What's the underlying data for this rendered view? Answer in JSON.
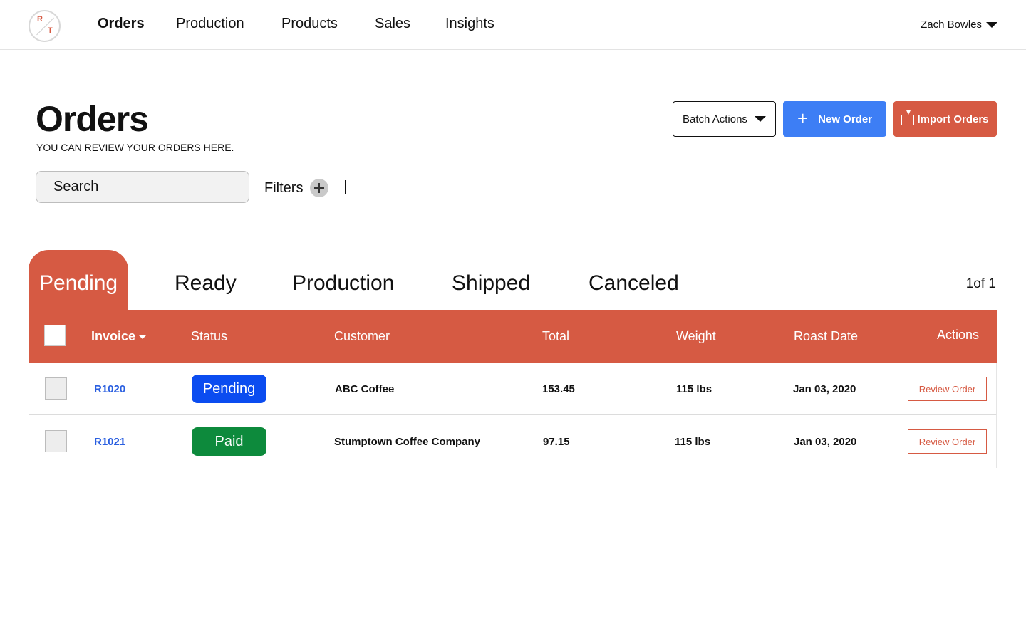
{
  "nav": {
    "logo": {
      "letters": [
        "R",
        "T"
      ]
    },
    "items": [
      {
        "label": "Orders",
        "active": true
      },
      {
        "label": "Production"
      },
      {
        "label": "Products"
      },
      {
        "label": "Sales"
      },
      {
        "label": "Insights"
      }
    ],
    "user": "Zach Bowles"
  },
  "header": {
    "title": "Orders",
    "subtitle": "YOU CAN REVIEW YOUR ORDERS HERE.",
    "batch_label": "Batch Actions",
    "new_order_label": "New Order",
    "import_label": "Import Orders"
  },
  "search": {
    "placeholder": "Search"
  },
  "filters": {
    "label": "Filters"
  },
  "tabs": [
    {
      "label": "Pending",
      "active": true
    },
    {
      "label": "Ready"
    },
    {
      "label": "Production"
    },
    {
      "label": "Shipped"
    },
    {
      "label": "Canceled"
    }
  ],
  "pagination": "1of 1",
  "table": {
    "columns": {
      "invoice": "Invoice",
      "status": "Status",
      "customer": "Customer",
      "total": "Total",
      "weight": "Weight",
      "roast_date": "Roast Date",
      "actions": "Actions"
    },
    "rows": [
      {
        "invoice": "R1020",
        "status": "Pending",
        "customer": "ABC Coffee",
        "total": "153.45",
        "weight": "115 lbs",
        "roast_date": "Jan 03, 2020",
        "action": "Review Order"
      },
      {
        "invoice": "R1021",
        "status": "Paid",
        "customer": "Stumptown Coffee Company",
        "total": "97.15",
        "weight": "115 lbs",
        "roast_date": "Jan 03, 2020",
        "action": "Review Order"
      }
    ]
  },
  "colors": {
    "accent": "#d65a43",
    "primary_blue": "#3d7ef5",
    "pending_badge": "#0b4cf0",
    "paid_badge": "#0d8a3c",
    "link": "#2a5fe0"
  }
}
